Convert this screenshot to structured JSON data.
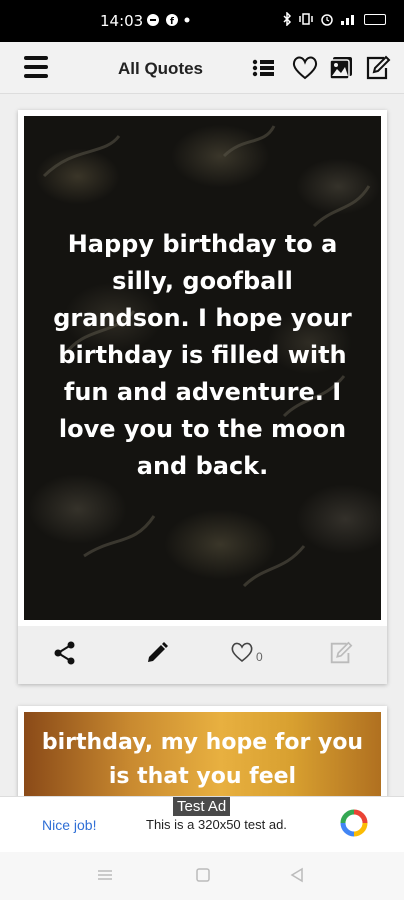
{
  "status_bar": {
    "time": "14:03",
    "battery_level": 0.8
  },
  "app_bar": {
    "title": "All Quotes"
  },
  "cards": [
    {
      "quote": "Happy birthday to a silly, goofball grandson. I hope your birthday is filled with fun and adventure. I love you to the moon and back.",
      "like_count": "0"
    },
    {
      "quote_partial": "birthday, my hope for you is that you feel"
    }
  ],
  "ad": {
    "tag": "Test Ad",
    "cta": "Nice job!",
    "text": "This is a 320x50 test ad."
  },
  "colors": {
    "accent": "#2f6fd6",
    "status_bar": "#000000",
    "app_bar": "#f2f2f2"
  }
}
